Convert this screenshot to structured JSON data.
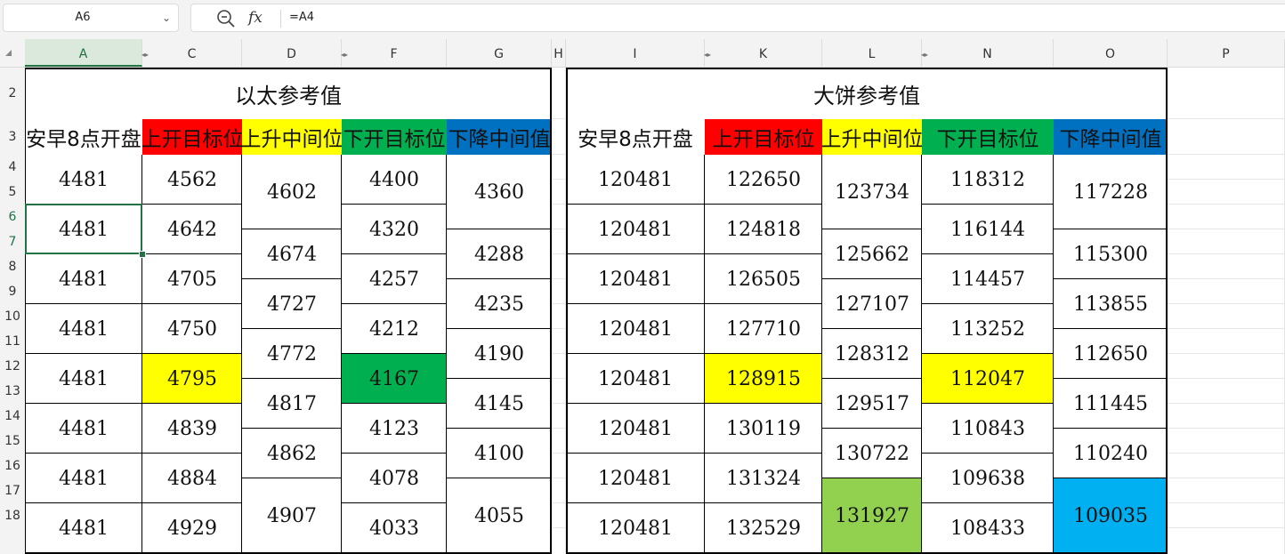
{
  "formula_bar": {
    "name_box": "A6",
    "formula": "=A4",
    "fx_label": "fx"
  },
  "columns": [
    "A",
    "C",
    "D",
    "F",
    "G",
    "H",
    "I",
    "K",
    "L",
    "N",
    "O",
    "P"
  ],
  "rows": [
    "2",
    "3",
    "4",
    "5",
    "6",
    "7",
    "8",
    "9",
    "10",
    "11",
    "12",
    "13",
    "14",
    "15",
    "16",
    "17",
    "18"
  ],
  "selected": {
    "column": "A",
    "rows": [
      "6",
      "7"
    ]
  },
  "sections": [
    {
      "title": "以太参考值",
      "headers": [
        "安早8点开盘",
        "上开目标位",
        "上升中间位",
        "下开目标位",
        "下降中间值"
      ],
      "open": [
        "4481",
        "4481",
        "4481",
        "4481",
        "4481",
        "4481",
        "4481",
        "4481"
      ],
      "up_target": [
        "4562",
        "4642",
        "4705",
        "4750",
        "4795",
        "4839",
        "4884",
        "4929"
      ],
      "up_mid": [
        "4602",
        "4674",
        "4727",
        "4772",
        "4817",
        "4862",
        "4907"
      ],
      "down_target": [
        "4400",
        "4320",
        "4257",
        "4212",
        "4167",
        "4123",
        "4078",
        "4033"
      ],
      "down_mid": [
        "4360",
        "4288",
        "4235",
        "4190",
        "4145",
        "4100",
        "4055"
      ]
    },
    {
      "title": "大饼参考值",
      "headers": [
        "安早8点开盘",
        "上开目标位",
        "上升中间位",
        "下开目标位",
        "下降中间值"
      ],
      "open": [
        "120481",
        "120481",
        "120481",
        "120481",
        "120481",
        "120481",
        "120481",
        "120481"
      ],
      "up_target": [
        "122650",
        "124818",
        "126505",
        "127710",
        "128915",
        "130119",
        "131324",
        "132529"
      ],
      "up_mid": [
        "123734",
        "125662",
        "127107",
        "128312",
        "129517",
        "130722",
        "131927"
      ],
      "down_target": [
        "118312",
        "116144",
        "114457",
        "113252",
        "112047",
        "110843",
        "109638",
        "108433"
      ],
      "down_mid": [
        "117228",
        "115300",
        "113855",
        "112650",
        "111445",
        "110240",
        "109035"
      ]
    }
  ],
  "colors": {
    "header_up_target": "#ff0000",
    "header_up_mid": "#ffff00",
    "header_down_target": "#00b050",
    "header_down_mid": "#0070c0",
    "highlight_yellow": "#ffff00",
    "highlight_green": "#00b050",
    "highlight_lightgreen": "#92d050",
    "highlight_cyan": "#00b0f0",
    "selection": "#217346"
  }
}
